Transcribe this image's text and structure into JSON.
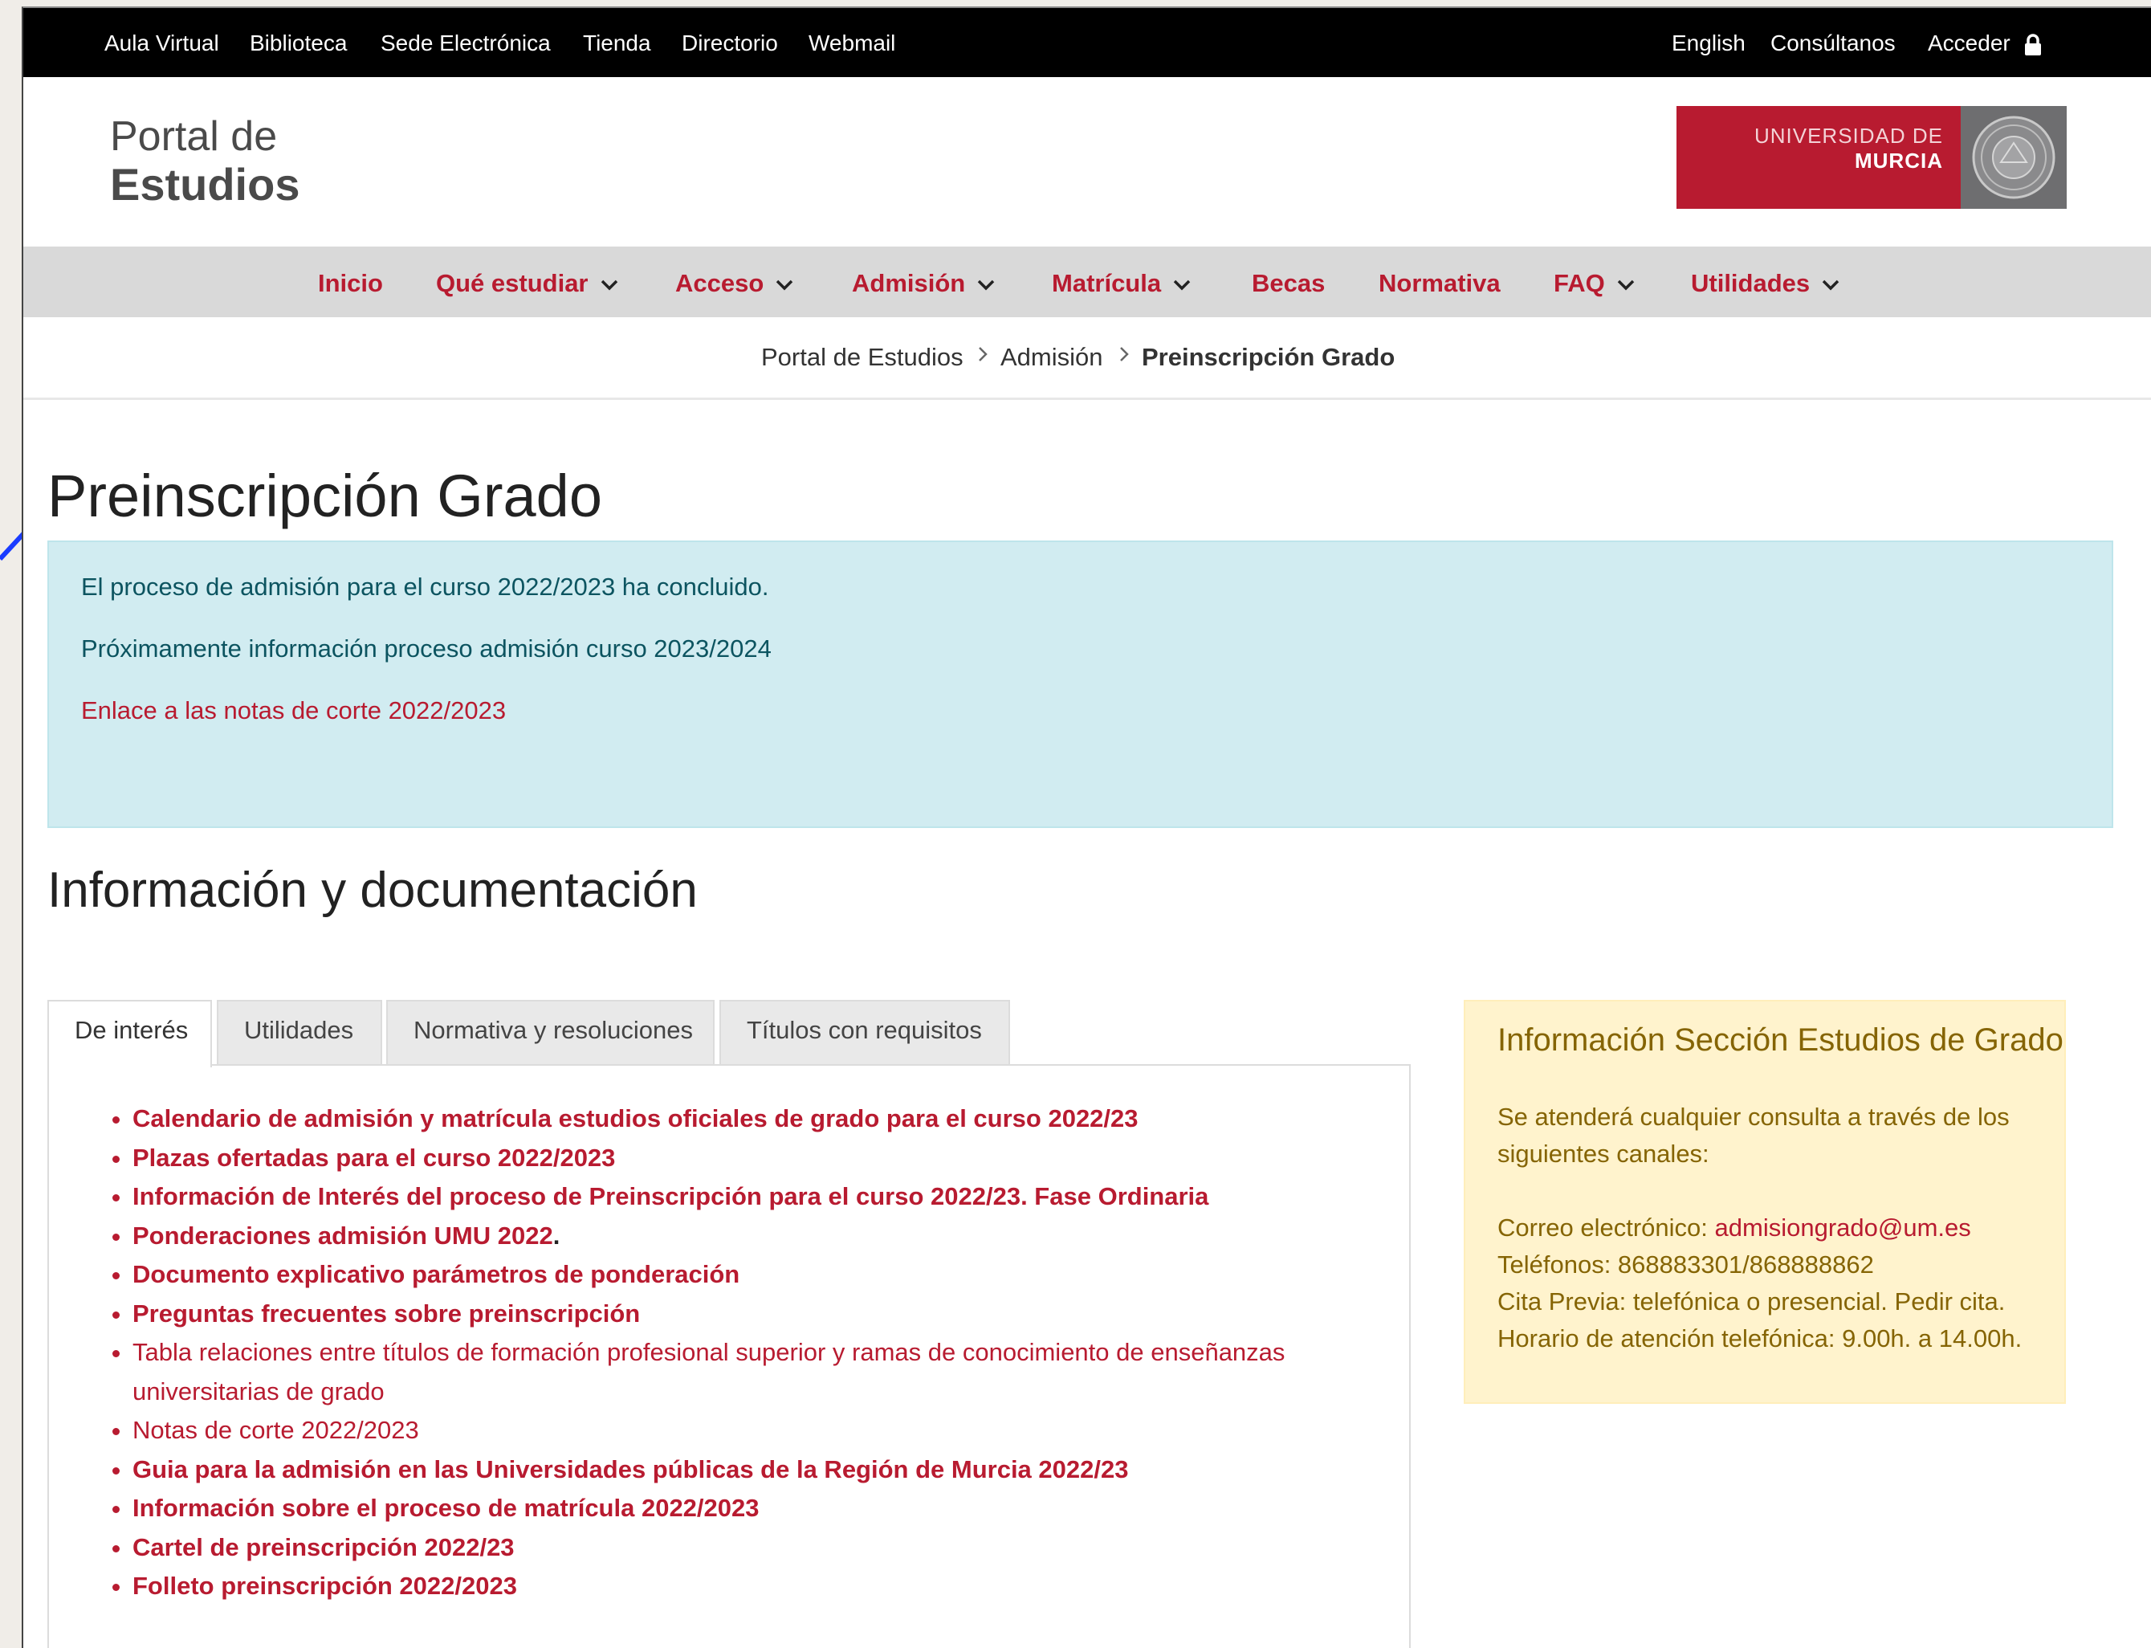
{
  "topbar": {
    "left_links": [
      "Aula Virtual",
      "Biblioteca",
      "Sede Electrónica",
      "Tienda",
      "Directorio",
      "Webmail"
    ],
    "english": "English",
    "contact": "Consúltanos",
    "login": "Acceder",
    "login_icon": "lock-icon"
  },
  "header": {
    "title_line1": "Portal de",
    "title_line2": "Estudios",
    "logo_line1": "UNIVERSIDAD DE",
    "logo_line2": "MURCIA",
    "brand_color": "#b81b30"
  },
  "nav": {
    "items": [
      {
        "label": "Inicio"
      },
      {
        "label": "Qué estudiar"
      },
      {
        "label": "Acceso"
      },
      {
        "label": "Admisión"
      },
      {
        "label": "Matrícula"
      },
      {
        "label": "Becas"
      },
      {
        "label": "Normativa"
      },
      {
        "label": "FAQ"
      },
      {
        "label": "Utilidades"
      }
    ]
  },
  "breadcrumb": {
    "items": [
      "Portal de Estudios",
      "Admisión",
      "Preinscripción Grado"
    ]
  },
  "main": {
    "title": "Preinscripción Grado",
    "alert": {
      "line1": "El proceso de admisión para el curso 2022/2023 ha concluido.",
      "line2": "Próximamente información proceso admisión curso 2023/2024",
      "link": "Enlace a las notas de corte 2022/2023"
    },
    "section_title": "Información y documentación",
    "tabs": [
      "De interés",
      "Utilidades",
      "Normativa y resoluciones",
      "Títulos con requisitos"
    ],
    "list": [
      "Calendario de admisión y matrícula estudios oficiales de grado para el curso 2022/23",
      "Plazas ofertadas para el curso 2022/2023",
      "Información de Interés del proceso de Preinscripción para el curso 2022/23. Fase Ordinaria",
      "Ponderaciones admisión UMU 2022",
      "Documento explicativo parámetros de ponderación",
      "Preguntas frecuentes sobre preinscripción",
      "Tabla relaciones entre títulos de formación profesional superior y ramas de conocimiento de enseñanzas universitarias de grado",
      "Notas de corte 2022/2023",
      "Guia para la admisión en las Universidades públicas de la Región de Murcia 2022/23",
      "Información sobre el proceso de matrícula 2022/2023",
      "Cartel de preinscripción 2022/23",
      "Folleto preinscripción 2022/2023"
    ],
    "list_suffix_4": "."
  },
  "infobox": {
    "title": "Información Sección Estudios de Grado",
    "intro_line1": "Se atenderá cualquier consulta a través de los",
    "intro_line2": "siguientes canales:",
    "email_label": "Correo electrónico: ",
    "email": "admisiongrado@um.es",
    "phones": "Teléfonos: 868883301/868888862",
    "appointment": "Cita Previa: telefónica o presencial. Pedir cita.",
    "hours": "Horario de atención telefónica: 9.00h. a 14.00h."
  }
}
